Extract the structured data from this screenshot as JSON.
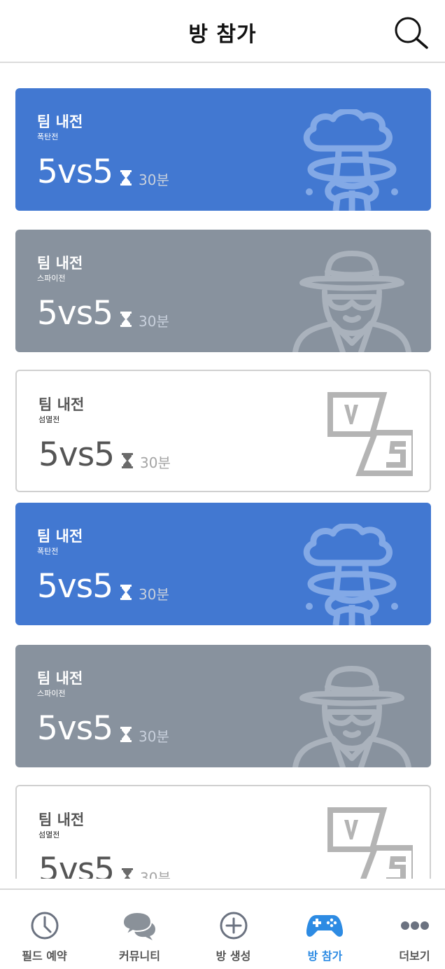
{
  "header": {
    "title": "방 참가",
    "search_icon": "search-icon"
  },
  "rooms": [
    {
      "title": "팀 내전",
      "mode": "폭탄전",
      "matchup": "5vs5",
      "duration": "30분",
      "style": "blue",
      "icon": "explosion-icon"
    },
    {
      "title": "팀 내전",
      "mode": "스파이전",
      "matchup": "5vs5",
      "duration": "30분",
      "style": "grey",
      "icon": "spy-icon"
    },
    {
      "title": "팀 내전",
      "mode": "섬멸전",
      "matchup": "5vs5",
      "duration": "30분",
      "style": "white",
      "icon": "versus-icon"
    },
    {
      "title": "팀 내전",
      "mode": "폭탄전",
      "matchup": "5vs5",
      "duration": "30분",
      "style": "blue",
      "icon": "explosion-icon"
    },
    {
      "title": "팀 내전",
      "mode": "스파이전",
      "matchup": "5vs5",
      "duration": "30분",
      "style": "grey",
      "icon": "spy-icon"
    },
    {
      "title": "팀 내전",
      "mode": "섬멸전",
      "matchup": "5vs5",
      "duration": "30분",
      "style": "white",
      "icon": "versus-icon"
    }
  ],
  "nav": {
    "items": [
      {
        "label": "필드 예약",
        "icon": "clock-icon",
        "active": false
      },
      {
        "label": "커뮤니티",
        "icon": "chat-bubbles-icon",
        "active": false
      },
      {
        "label": "방 생성",
        "icon": "plus-circle-icon",
        "active": false
      },
      {
        "label": "방 참가",
        "icon": "gamepad-icon",
        "active": true
      },
      {
        "label": "더보기",
        "icon": "more-dots-icon",
        "active": false
      }
    ]
  },
  "colors": {
    "blue": "#4278d1",
    "grey": "#88929e",
    "active": "#2d8be3",
    "inactive": "#555555"
  }
}
